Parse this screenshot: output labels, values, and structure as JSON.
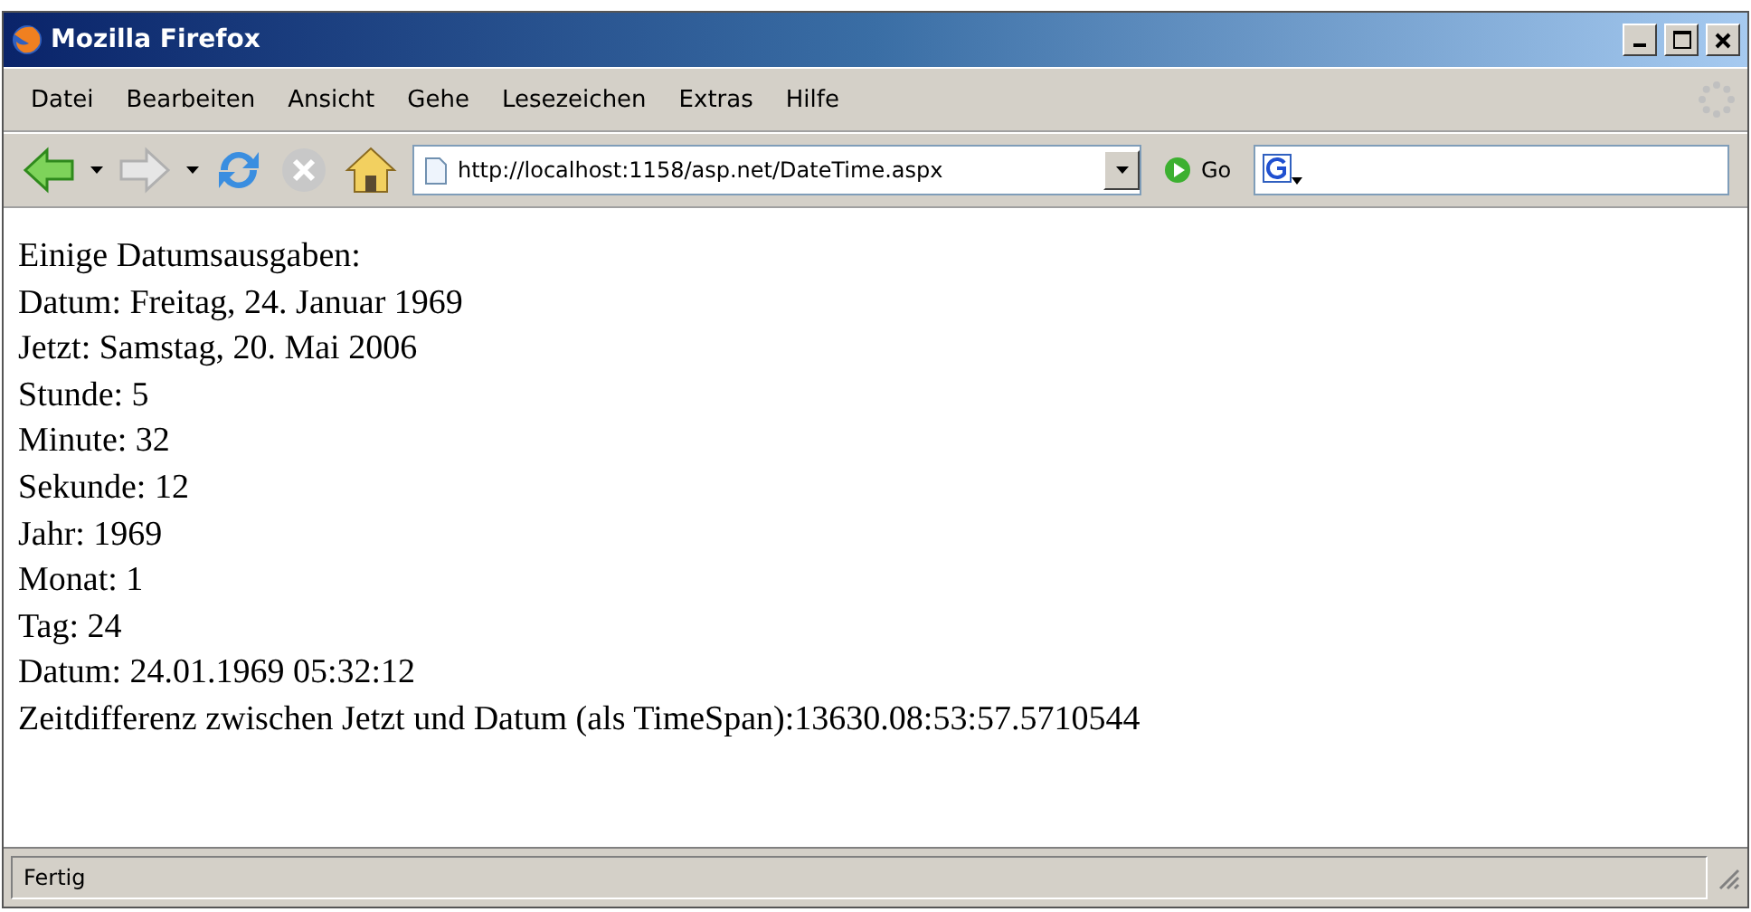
{
  "window": {
    "title": "Mozilla Firefox"
  },
  "menu": [
    {
      "label": "Datei"
    },
    {
      "label": "Bearbeiten"
    },
    {
      "label": "Ansicht"
    },
    {
      "label": "Gehe"
    },
    {
      "label": "Lesezeichen"
    },
    {
      "label": "Extras"
    },
    {
      "label": "Hilfe"
    }
  ],
  "toolbar": {
    "address": "http://localhost:1158/asp.net/DateTime.aspx",
    "go": "Go",
    "forward_disabled": true,
    "stop_disabled": true
  },
  "content": [
    "Einige Datumsausgaben:",
    "Datum: Freitag, 24. Januar 1969",
    "Jetzt: Samstag, 20. Mai 2006",
    "Stunde: 5",
    "Minute: 32",
    "Sekunde: 12",
    "Jahr: 1969",
    "Monat: 1",
    "Tag: 24",
    "Datum: 24.01.1969 05:32:12",
    "Zeitdifferenz zwischen Jetzt und Datum (als TimeSpan):13630.08:53:57.5710544"
  ],
  "status_bar": "Fertig"
}
